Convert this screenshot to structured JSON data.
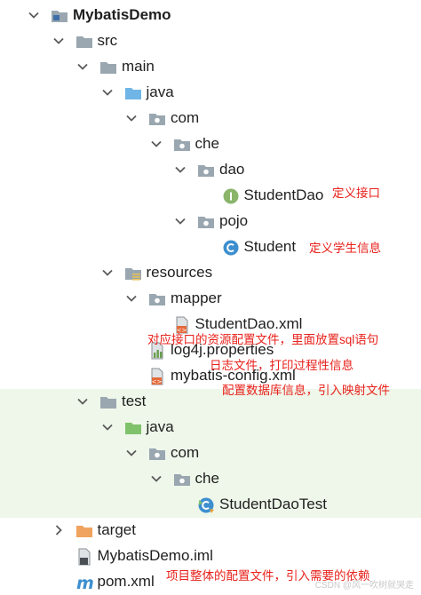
{
  "tree": [
    {
      "label": "MybatisDemo",
      "icon": "module-folder-icon",
      "expand": "expanded",
      "bold": true
    },
    {
      "label": "src",
      "icon": "folder-icon",
      "expand": "expanded"
    },
    {
      "label": "main",
      "icon": "folder-icon",
      "expand": "expanded"
    },
    {
      "label": "java",
      "icon": "source-root-folder-icon",
      "expand": "expanded"
    },
    {
      "label": "com",
      "icon": "package-icon",
      "expand": "expanded"
    },
    {
      "label": "che",
      "icon": "package-icon",
      "expand": "expanded"
    },
    {
      "label": "dao",
      "icon": "package-icon",
      "expand": "expanded"
    },
    {
      "label": "StudentDao",
      "icon": "interface-icon",
      "expand": "none"
    },
    {
      "label": "pojo",
      "icon": "package-icon",
      "expand": "expanded"
    },
    {
      "label": "Student",
      "icon": "class-icon",
      "expand": "none"
    },
    {
      "label": "resources",
      "icon": "resources-folder-icon",
      "expand": "expanded"
    },
    {
      "label": "mapper",
      "icon": "package-icon",
      "expand": "expanded"
    },
    {
      "label": "StudentDao.xml",
      "icon": "xml-file-icon",
      "expand": "none"
    },
    {
      "label": "log4j.properties",
      "icon": "properties-file-icon",
      "expand": "none"
    },
    {
      "label": "mybatis-config.xml",
      "icon": "xml-file-icon",
      "expand": "none"
    },
    {
      "label": "test",
      "icon": "folder-icon",
      "expand": "expanded"
    },
    {
      "label": "java",
      "icon": "test-root-folder-icon",
      "expand": "expanded"
    },
    {
      "label": "com",
      "icon": "package-icon",
      "expand": "expanded"
    },
    {
      "label": "che",
      "icon": "package-icon",
      "expand": "expanded"
    },
    {
      "label": "StudentDaoTest",
      "icon": "test-class-icon",
      "expand": "none"
    },
    {
      "label": "target",
      "icon": "excluded-folder-icon",
      "expand": "collapsed"
    },
    {
      "label": "MybatisDemo.iml",
      "icon": "iml-file-icon",
      "expand": "none"
    },
    {
      "label": "pom.xml",
      "icon": "maven-icon",
      "expand": "none"
    }
  ],
  "annotations": {
    "dao_interface": "定义接口",
    "student_class": "定义学生信息",
    "mapper_xml": "对应接口的资源配置文件，里面放置sql语句",
    "log4j": "日志文件，打印过程性信息",
    "mybatis_config": "配置数据库信息，引入映射文件",
    "pom": "项目整体的配置文件，引入需要的依赖"
  },
  "watermark": "CSDN @风一吹树就哭走",
  "colors": {
    "annotation": "#e8211b",
    "test_highlight": "#eef7ea",
    "folder": "#9aa7b0",
    "source_root": "#6fb5e6",
    "test_root": "#7fc26b",
    "excluded": "#f0a35e",
    "interface": "#8ab56b",
    "class": "#3d8fcf"
  }
}
